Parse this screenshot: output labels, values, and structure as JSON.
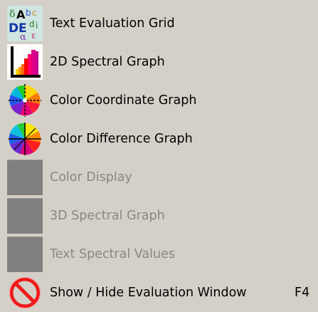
{
  "menu": {
    "items": [
      {
        "label": "Text Evaluation Grid",
        "icon": "text-evaluation-grid-icon",
        "enabled": true
      },
      {
        "label": "2D Spectral Graph",
        "icon": "spectral-graph-2d-icon",
        "enabled": true
      },
      {
        "label": "Color Coordinate Graph",
        "icon": "color-coordinate-graph-icon",
        "enabled": true
      },
      {
        "label": "Color Difference Graph",
        "icon": "color-difference-graph-icon",
        "enabled": true
      },
      {
        "label": "Color Display",
        "icon": "color-display-icon",
        "enabled": false
      },
      {
        "label": "3D Spectral Graph",
        "icon": "spectral-graph-3d-icon",
        "enabled": false
      },
      {
        "label": "Text Spectral Values",
        "icon": "text-spectral-values-icon",
        "enabled": false
      },
      {
        "label": "Show / Hide Evaluation Window",
        "icon": "no-entry-icon",
        "enabled": true,
        "shortcut": "F4"
      }
    ]
  },
  "colors": {
    "menu_background": "#d4d0c8",
    "disabled_text": "#8a8780",
    "disabled_icon": "#808080"
  }
}
